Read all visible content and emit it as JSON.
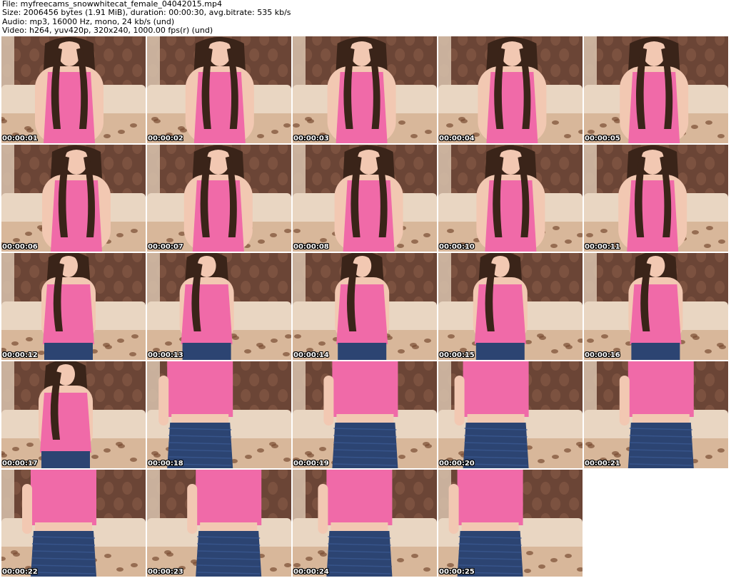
{
  "header": {
    "file_line": "File: myfreecams_snowwhitecat_female_04042015.mp4",
    "size_line": "Size: 2006456 bytes (1.91 MiB), duration: 00:00:30, avg.bitrate: 535 kb/s",
    "audio_line": "Audio: mp3, 16000 Hz, mono, 24 kb/s (und)",
    "video_line": "Video: h264, yuv420p, 320x240, 1000.00 fps(r) (und)"
  },
  "colors": {
    "wall": "#6b4536",
    "wall_pattern": "#8a5d48",
    "sofa": "#e9d6c2",
    "top_pink": "#f06aa8",
    "skirt": "#2c4472",
    "hair": "#3a2419",
    "skin": "#f2c8b2",
    "curtain": "#d9c3ae"
  },
  "thumbnails": [
    {
      "timestamp": "00:00:01",
      "scene": "seated"
    },
    {
      "timestamp": "00:00:02",
      "scene": "seated"
    },
    {
      "timestamp": "00:00:03",
      "scene": "seated"
    },
    {
      "timestamp": "00:00:04",
      "scene": "seated"
    },
    {
      "timestamp": "00:00:05",
      "scene": "seated"
    },
    {
      "timestamp": "00:00:06",
      "scene": "seated"
    },
    {
      "timestamp": "00:00:07",
      "scene": "seated"
    },
    {
      "timestamp": "00:00:08",
      "scene": "seated"
    },
    {
      "timestamp": "00:00:10",
      "scene": "seated"
    },
    {
      "timestamp": "00:00:11",
      "scene": "seated"
    },
    {
      "timestamp": "00:00:12",
      "scene": "standing"
    },
    {
      "timestamp": "00:00:13",
      "scene": "standing"
    },
    {
      "timestamp": "00:00:14",
      "scene": "standing"
    },
    {
      "timestamp": "00:00:15",
      "scene": "standing"
    },
    {
      "timestamp": "00:00:16",
      "scene": "standing"
    },
    {
      "timestamp": "00:00:17",
      "scene": "standing"
    },
    {
      "timestamp": "00:00:18",
      "scene": "closeup"
    },
    {
      "timestamp": "00:00:19",
      "scene": "closeup"
    },
    {
      "timestamp": "00:00:20",
      "scene": "closeup"
    },
    {
      "timestamp": "00:00:21",
      "scene": "closeup"
    },
    {
      "timestamp": "00:00:22",
      "scene": "closeup"
    },
    {
      "timestamp": "00:00:23",
      "scene": "closeup"
    },
    {
      "timestamp": "00:00:24",
      "scene": "closeup"
    },
    {
      "timestamp": "00:00:25",
      "scene": "closeup"
    }
  ]
}
